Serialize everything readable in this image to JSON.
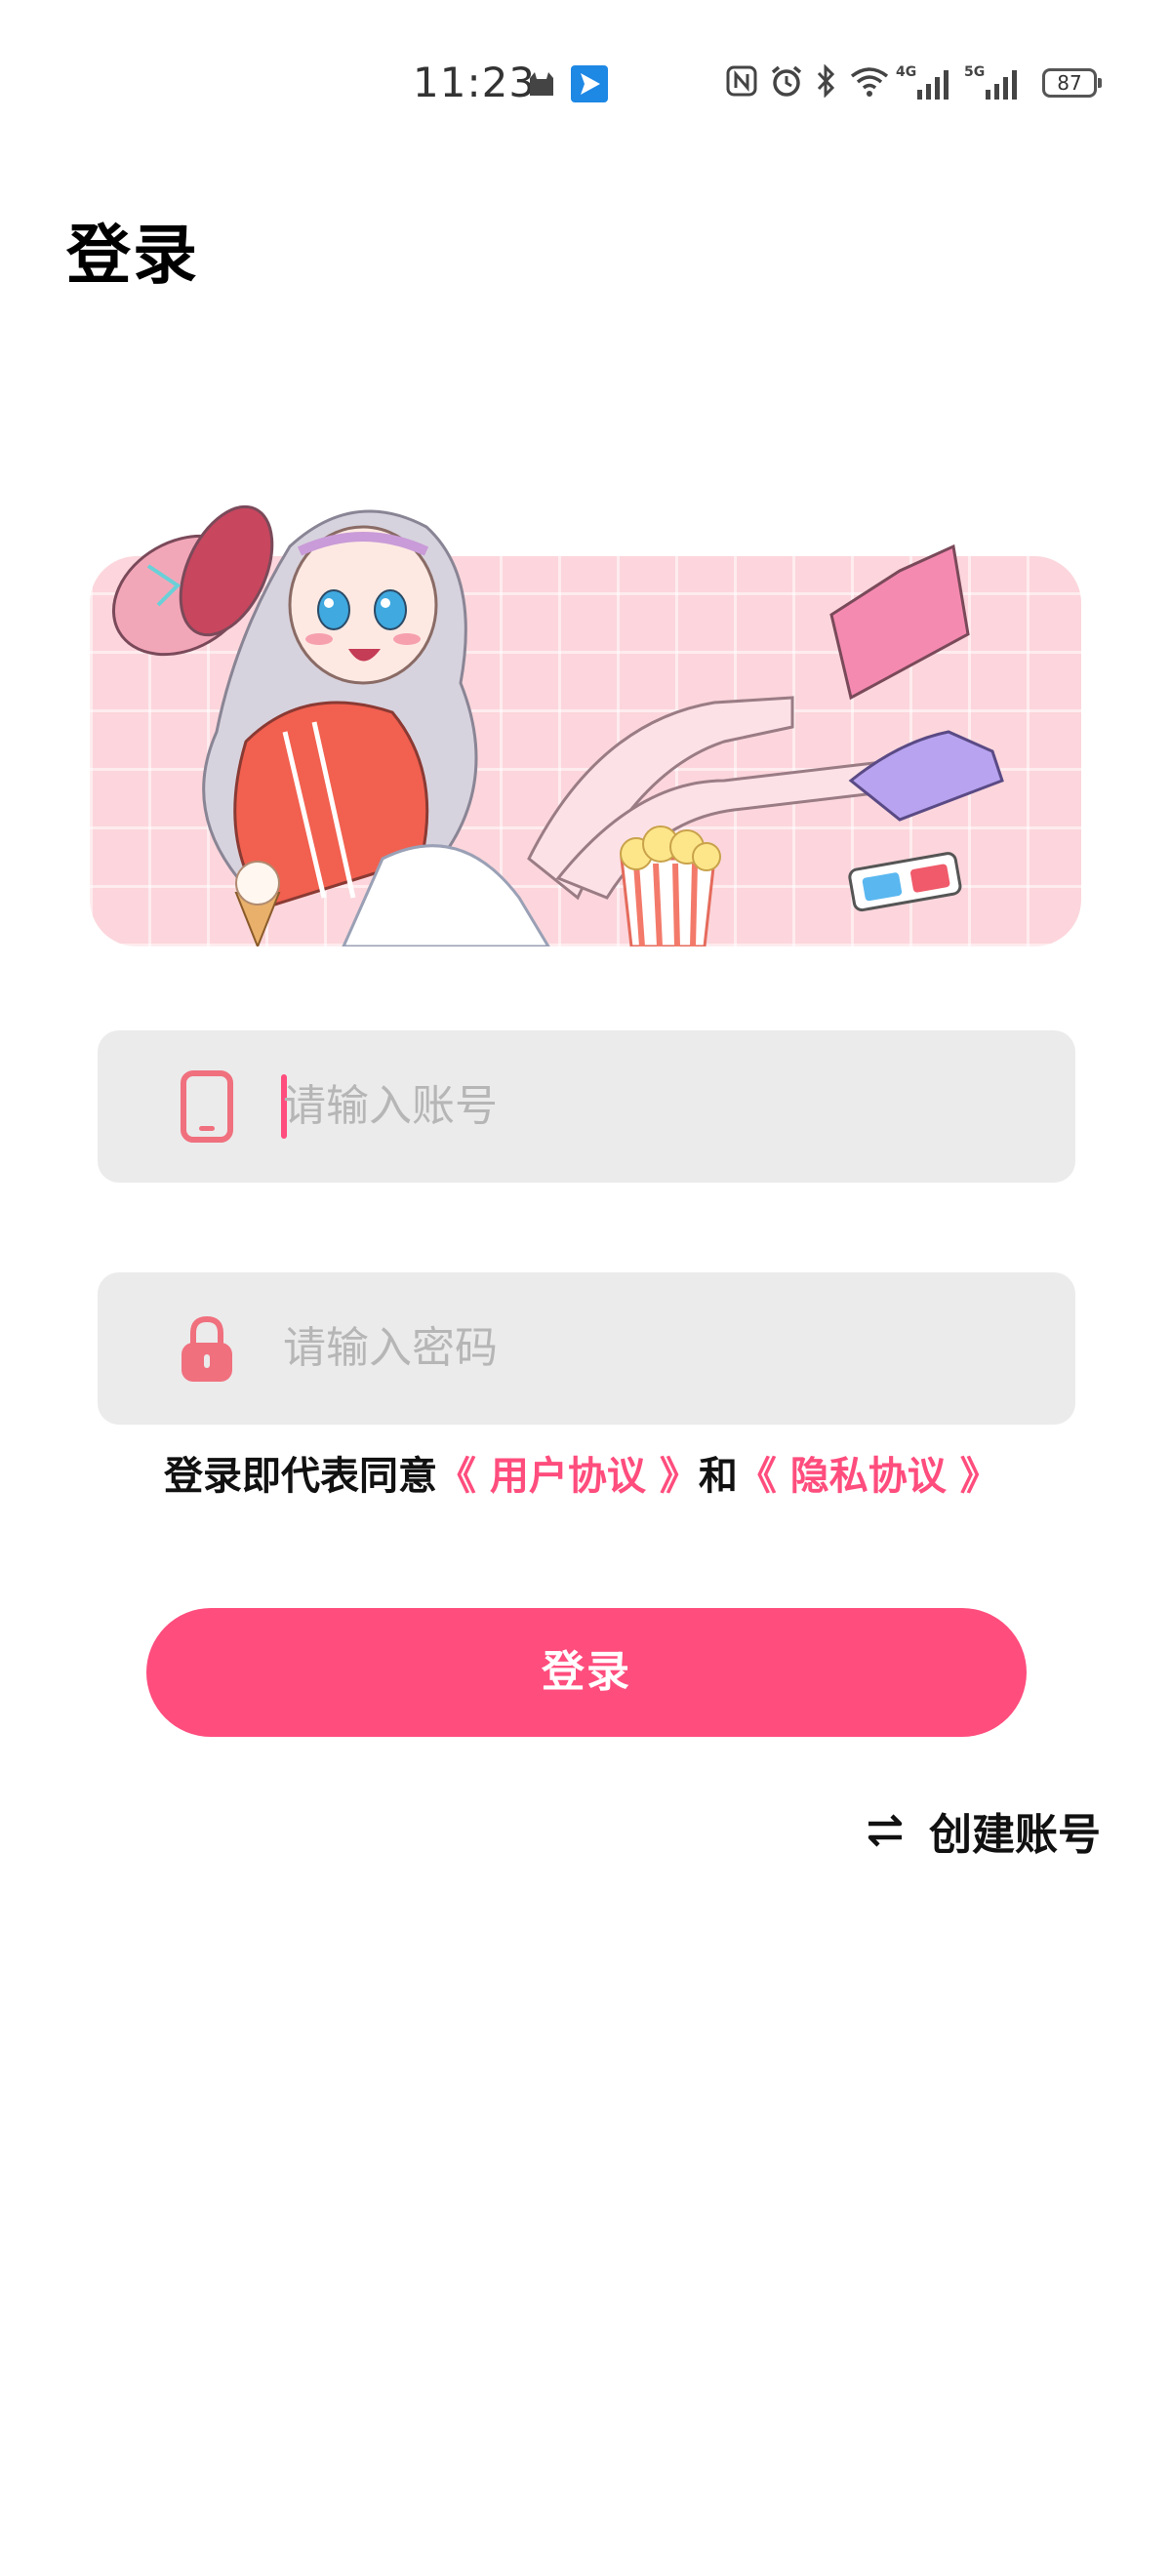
{
  "status_bar": {
    "time": "11:23",
    "battery": "87",
    "network_1": "4G",
    "network_2": "5G",
    "icons": [
      "cat-icon",
      "telegram-icon",
      "nfc-icon",
      "alarm-icon",
      "bluetooth-icon",
      "wifi-icon",
      "signal-icon",
      "signal-icon",
      "battery-icon"
    ]
  },
  "header": {
    "title": "登录"
  },
  "banner": {
    "image": "anime-girl-illustration"
  },
  "form": {
    "account_placeholder": "请输入账号",
    "account_icon": "phone-icon",
    "password_placeholder": "请输入密码",
    "password_icon": "lock-icon"
  },
  "agreement": {
    "prefix": "登录即代表同意",
    "user_agreement": "《 用户协议 》",
    "conjunction": "和",
    "privacy_policy": "《 隐私协议 》"
  },
  "actions": {
    "login_label": "登录",
    "create_account_label": "创建账号",
    "create_account_icon": "swap-icon"
  },
  "colors": {
    "accent": "#ff4d7d",
    "input_bg": "#ebebeb",
    "banner_bg": "#fcd6dc",
    "placeholder": "#b6b6b6"
  }
}
